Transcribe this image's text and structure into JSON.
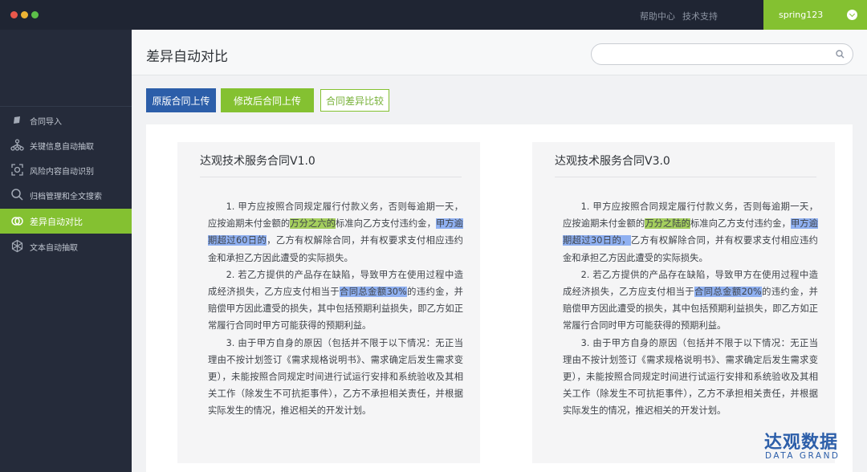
{
  "topbar": {
    "links": [
      "帮助中心",
      "技术支持"
    ],
    "user": {
      "name": "spring123"
    },
    "accent_color": "#84c131"
  },
  "sidebar": {
    "items": [
      {
        "label": "合同导入",
        "icon": "book-icon",
        "active": false
      },
      {
        "label": "关键信息自动抽取",
        "icon": "hierarchy-icon",
        "active": false
      },
      {
        "label": "风险内容自动识别",
        "icon": "scan-icon",
        "active": false
      },
      {
        "label": "归档管理和全文搜索",
        "icon": "search-icon",
        "active": false
      },
      {
        "label": "差异自动对比",
        "icon": "compare-circles-icon",
        "active": true
      },
      {
        "label": "文本自动抽取",
        "icon": "network-icon",
        "active": false
      }
    ]
  },
  "header": {
    "title": "差异自动对比",
    "search": {
      "value": "",
      "placeholder": ""
    }
  },
  "toolbar": {
    "upload_original": "原版合同上传",
    "upload_modified": "修改后合同上传",
    "compare": "合同差异比较"
  },
  "documents": [
    {
      "title": "达观技术服务合同V1.0",
      "paragraphs": [
        [
          {
            "text": "1. 甲方应按照合同规定履行付款义务，否则每逾期一天，应按逾期未付金额的"
          },
          {
            "text": "万分之六的",
            "hl": "green"
          },
          {
            "text": "标准向乙方支付违约金，"
          },
          {
            "text": "甲方逾期超过60日的",
            "hl": "blue"
          },
          {
            "text": "，乙方有权解除合同，并有权要求支付相应违约金和承担乙方因此遭受的实际损失。"
          }
        ],
        [
          {
            "text": "2. 若乙方提供的产品存在缺陷，导致甲方在使用过程中造成经济损失，乙方应支付相当于"
          },
          {
            "text": "合同总金额30%",
            "hl": "blue"
          },
          {
            "text": "的违约金，并赔偿甲方因此遭受的损失，其中包括预期利益损失，即乙方如正常履行合同时甲方可能获得的预期利益。"
          }
        ],
        [
          {
            "text": "3. 由于甲方自身的原因（包括并不限于以下情况：无正当理由不按计划签订《需求规格说明书》、需求确定后发生需求变更），未能按照合同规定时间进行试运行安排和系统验收及其相关工作（除发生不可抗拒事件），乙方不承担相关责任，并根据实际发生的情况，推迟相关的开发计划。"
          }
        ]
      ]
    },
    {
      "title": "达观技术服务合同V3.0",
      "paragraphs": [
        [
          {
            "text": "1. 甲方应按照合同规定履行付款义务，否则每逾期一天，应按逾期未付金额的"
          },
          {
            "text": "万分之陆的",
            "hl": "green"
          },
          {
            "text": "标准向乙方支付违约金，"
          },
          {
            "text": "甲方逾期超过30日的，",
            "hl": "blue"
          },
          {
            "text": "乙方有权解除合同，并有权要求支付相应违约金和承担乙方因此遭受的实际损失。"
          }
        ],
        [
          {
            "text": "2. 若乙方提供的产品存在缺陷，导致甲方在使用过程中造成经济损失，乙方应支付相当于"
          },
          {
            "text": "合同总金额20%",
            "hl": "blue"
          },
          {
            "text": "的违约金，并赔偿甲方因此遭受的损失，其中包括预期利益损失，即乙方如正常履行合同时甲方可能获得的预期利益。"
          }
        ],
        [
          {
            "text": "3. 由于甲方自身的原因（包括并不限于以下情况：无正当理由不按计划签订《需求规格说明书》、需求确定后发生需求变更），未能按照合同规定时间进行试运行安排和系统验收及其相关工作（除发生不可抗拒事件），乙方不承担相关责任，并根据实际发生的情况，推迟相关的开发计划。"
          }
        ]
      ]
    }
  ],
  "logo": {
    "cn": "达观数据",
    "en": "DATA GRAND"
  },
  "colors": {
    "highlight_green": "#a5cf5e",
    "highlight_blue": "#8fb0f1",
    "brand_blue": "#2c5ea9",
    "sidebar_bg": "#252b3a"
  }
}
